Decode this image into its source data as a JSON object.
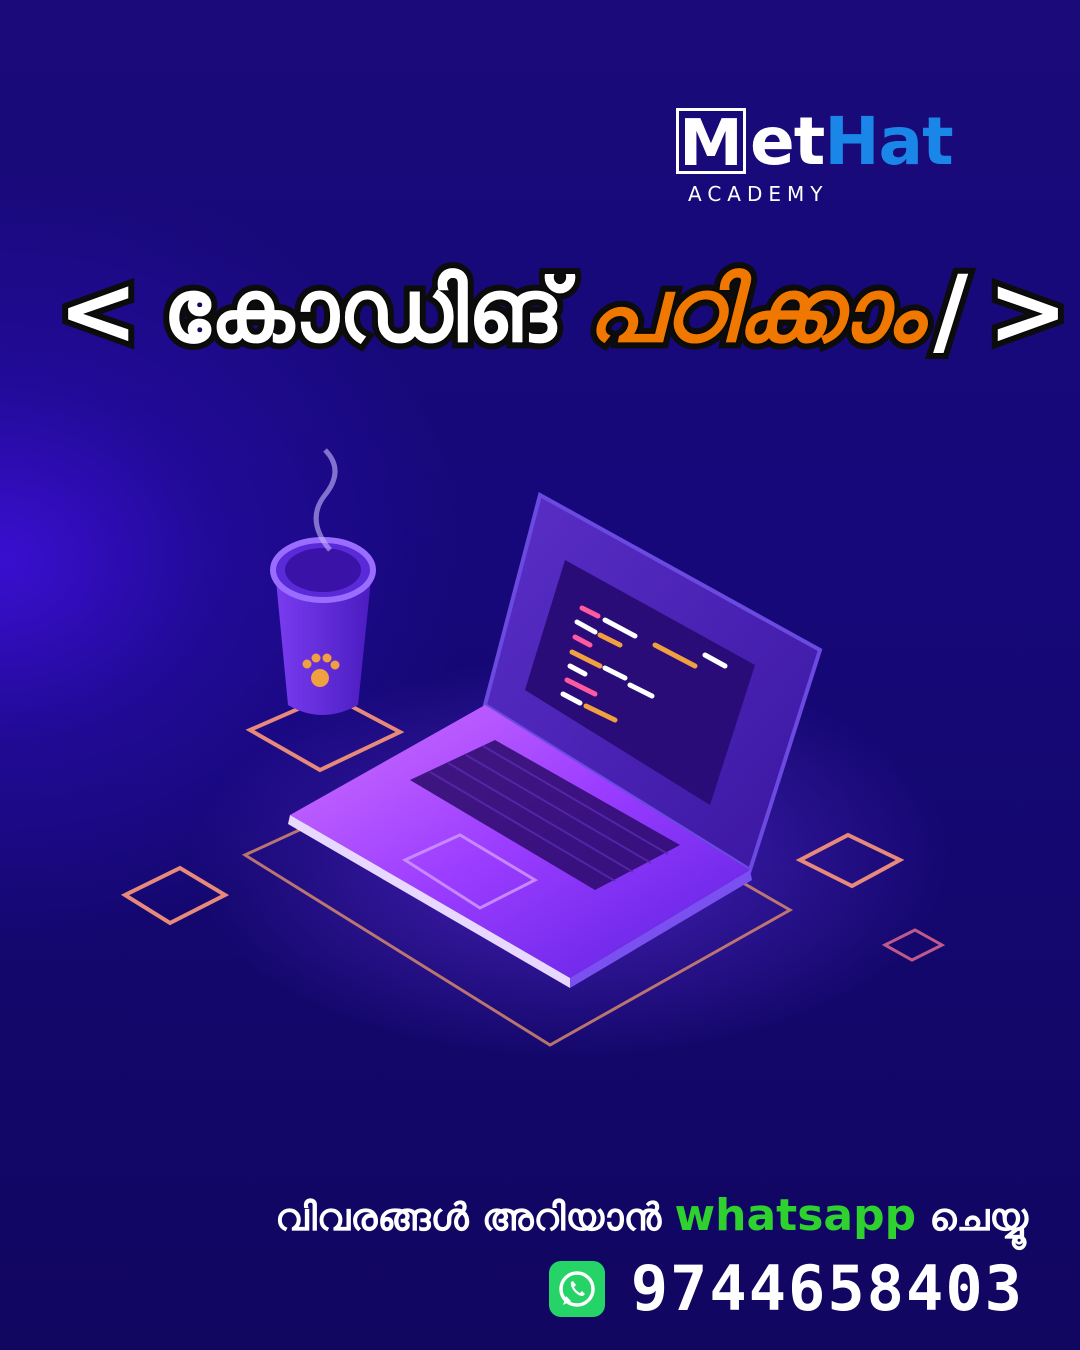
{
  "logo": {
    "letter": "M",
    "et": "et",
    "hat": "Hat",
    "subtitle": "ACADEMY",
    "hat_color": "#1a86e8"
  },
  "headline": {
    "open_bracket": "<",
    "word_white": "കോഡിങ്",
    "word_orange": "പഠിക്കാം",
    "slash": "/",
    "close_bracket": ">",
    "orange_color": "#f07800"
  },
  "illustration": {
    "icons": [
      "coffee-cup-icon",
      "paw-icon",
      "laptop-icon",
      "code-screen-icon",
      "keyboard-icon",
      "touchpad-icon"
    ]
  },
  "contact": {
    "info_prefix": "വിവരങ്ങൾ അറിയാൻ",
    "info_highlight": "whatsapp",
    "info_suffix": "ചെയ്യൂ",
    "highlight_color": "#2ed12e",
    "phone": "9744658403",
    "icon": "whatsapp-icon"
  }
}
